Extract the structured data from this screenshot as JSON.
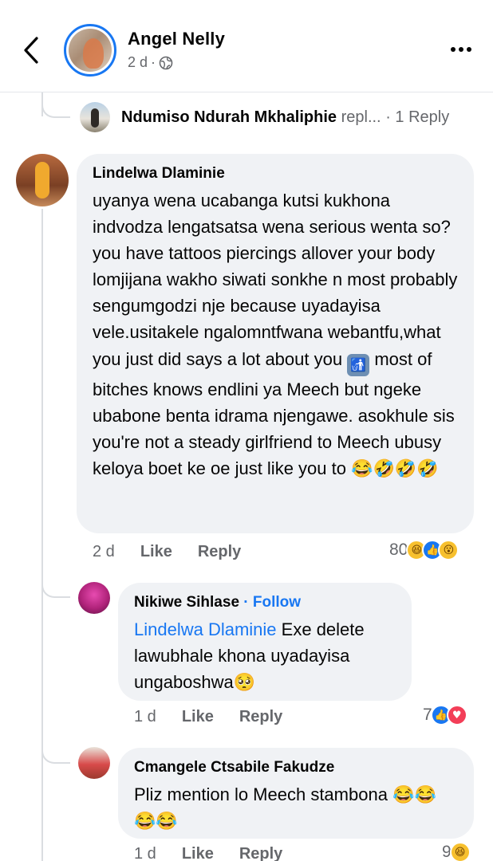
{
  "header": {
    "name": "Angel Nelly",
    "time": "2 d",
    "separator": "·",
    "audience_icon": "globe-icon"
  },
  "collapsed_reply": {
    "author": "Ndumiso Ndurah Mkhaliphie",
    "action": "repl...",
    "count": "· 1 Reply"
  },
  "comments": [
    {
      "author": "Lindelwa Dlaminie",
      "text_part1": "uyanya wena ucabanga kutsi kukhona indvodza lengatsatsa wena serious wenta so? you have tattoos piercings allover your body lomjijana wakho siwati sonkhe n most probably sengumgodzi nje because uyadayisa vele.usitakele ngalomntfwana webantfu,what you just did says a lot about you",
      "text_part2": "most of bitches knows endlini ya Meech but ngeke ubabone benta idrama njengawe. asokhule sis you're not a steady girlfriend to Meech ubusy keloya boet ke oe just like you to",
      "emoji_inline": "🚮",
      "emoji_end": "😂🤣🤣🤣",
      "time": "2 d",
      "like": "Like",
      "reply": "Reply",
      "reaction_count": "80",
      "reactions": [
        "haha",
        "like",
        "wow"
      ]
    },
    {
      "author": "Nikiwe Sihlase",
      "follow_sep": "·",
      "follow": "Follow",
      "mention": "Lindelwa Dlaminie",
      "text": "Exe delete lawubhale khona uyadayisa ungaboshwa",
      "emoji_end": "🥺",
      "time": "1 d",
      "like": "Like",
      "reply": "Reply",
      "reaction_count": "7",
      "reactions": [
        "like",
        "love"
      ]
    },
    {
      "author": "Cmangele Ctsabile Fakudze",
      "text": "Pliz mention lo Meech stambona",
      "emoji_end": "😂😂😂😂",
      "time": "1 d",
      "like": "Like",
      "reply": "Reply",
      "reaction_count": "9",
      "reactions": [
        "haha"
      ]
    }
  ],
  "colors": {
    "accent": "#1877f2",
    "bubble": "#f0f2f5",
    "muted": "#65676b",
    "love": "#f33e58"
  }
}
